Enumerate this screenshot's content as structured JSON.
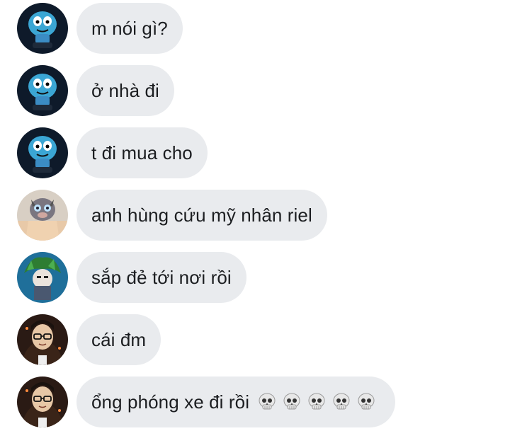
{
  "messages": [
    {
      "avatar": "gumball-avatar",
      "text": "m nói gì?"
    },
    {
      "avatar": "gumball-avatar",
      "text": "ở nhà đi"
    },
    {
      "avatar": "gumball-avatar",
      "text": "t đi mua cho"
    },
    {
      "avatar": "boar-mask-avatar",
      "text": "anh hùng cứu mỹ nhân riel"
    },
    {
      "avatar": "green-hair-avatar",
      "text": "sắp đẻ tới nơi rồi"
    },
    {
      "avatar": "glasses-avatar",
      "text": "cái đm"
    },
    {
      "avatar": "glasses-avatar",
      "text": "ổng phóng xe đi rồi",
      "emojis": [
        "skull-emoji",
        "skull-emoji",
        "skull-emoji",
        "skull-emoji",
        "skull-emoji"
      ]
    }
  ],
  "colors": {
    "bubble": "#e9ebee",
    "text": "#1c1e21"
  }
}
